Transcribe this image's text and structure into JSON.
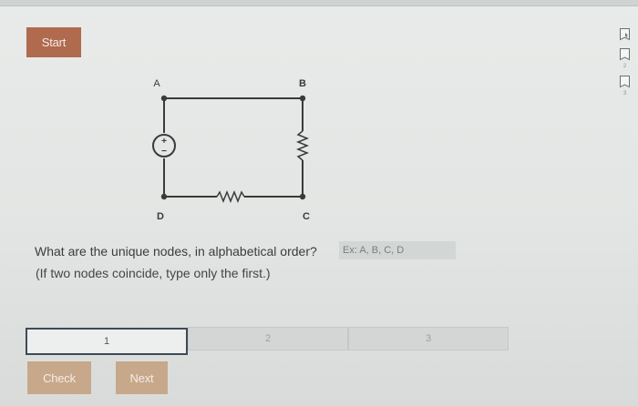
{
  "toolbar": {
    "start_label": "Start"
  },
  "circuit": {
    "nodes": {
      "a": "A",
      "b": "B",
      "c": "C",
      "d": "D"
    },
    "source_plus": "+",
    "source_minus": "−"
  },
  "question": {
    "text": "What are the unique nodes, in alphabetical order?",
    "hint": "(If two nodes coincide, type only the first.)",
    "answer_value": "",
    "answer_placeholder": "Ex: A, B, C, D"
  },
  "progress": {
    "steps": [
      {
        "label": "1"
      },
      {
        "label": "2"
      },
      {
        "label": "3"
      }
    ],
    "active_step": 1
  },
  "actions": {
    "check_label": "Check",
    "next_label": "Next"
  },
  "side_tools": {
    "items": [
      {
        "icon": "bookmark-icon",
        "label": ""
      },
      {
        "icon": "bookmark-icon",
        "label": "2"
      },
      {
        "icon": "bookmark-icon",
        "label": "3"
      }
    ]
  },
  "colors": {
    "start_button": "#b06a4e",
    "secondary_button": "#c7a88a",
    "active_step_border": "#3f4a56",
    "wire": "#3a3a3a"
  }
}
